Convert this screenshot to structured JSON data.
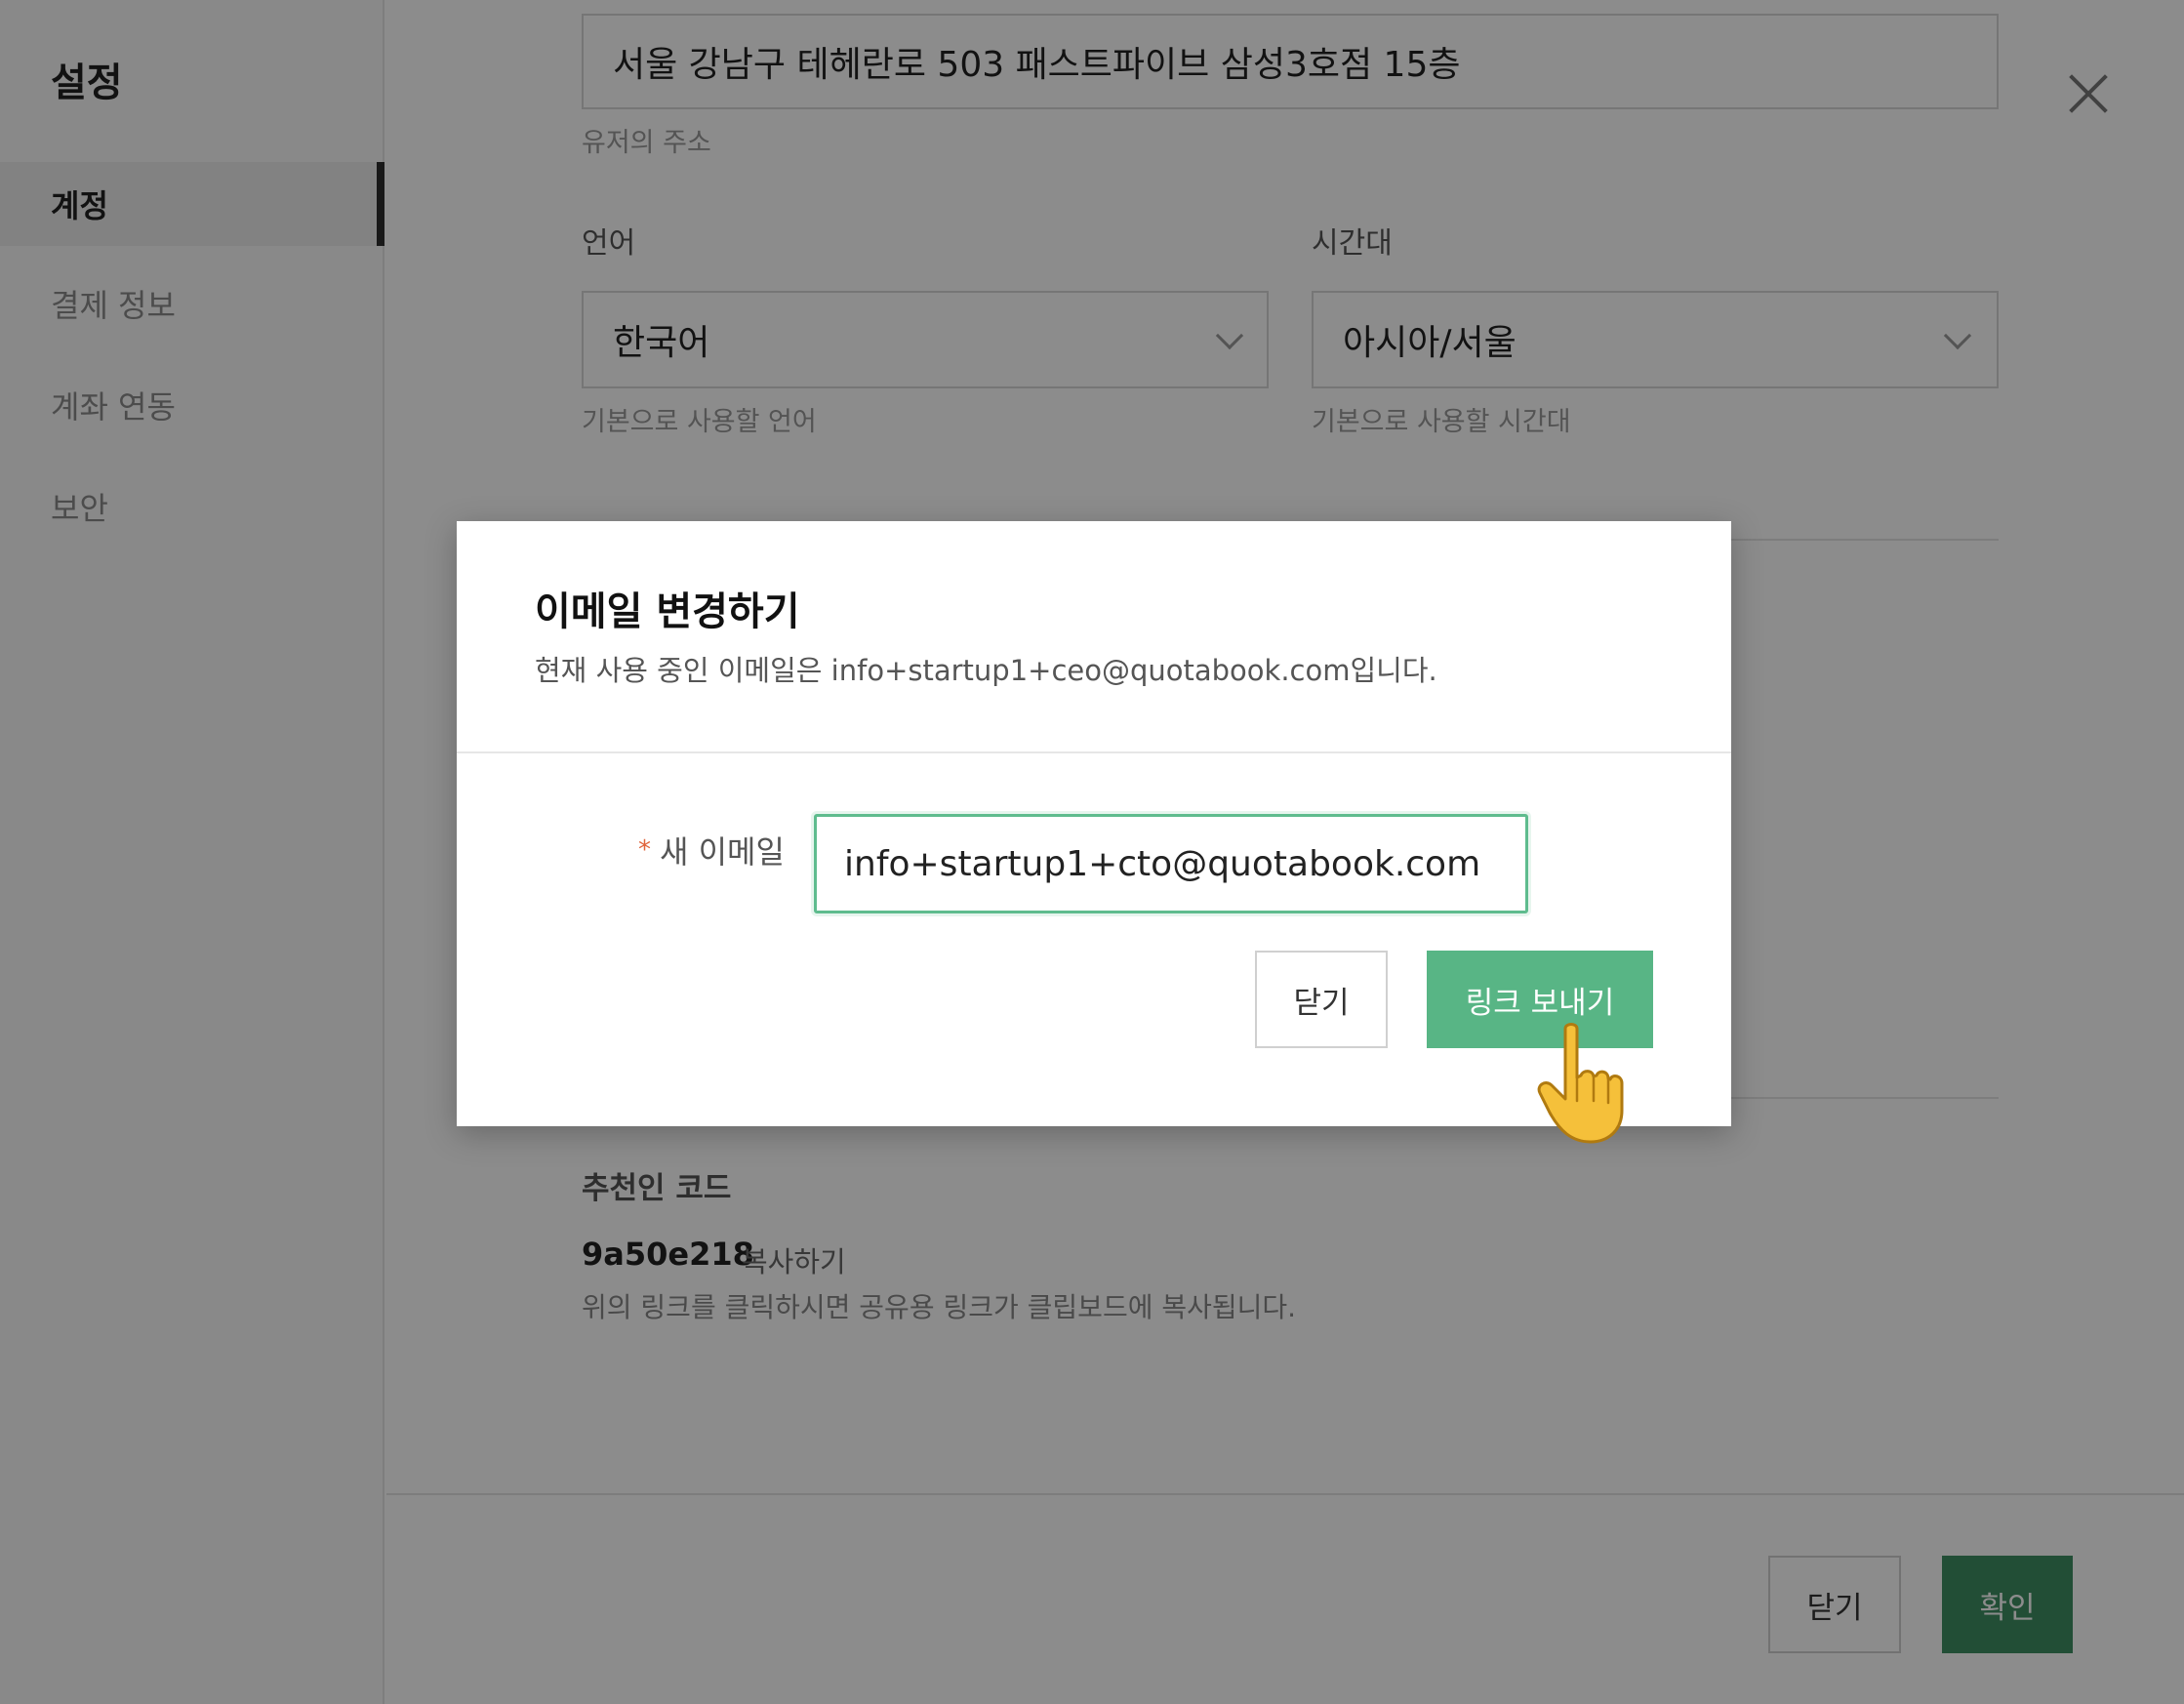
{
  "sidebar": {
    "title": "설정",
    "items": [
      {
        "label": "계정",
        "active": true
      },
      {
        "label": "결제 정보",
        "active": false
      },
      {
        "label": "계좌 연동",
        "active": false
      },
      {
        "label": "보안",
        "active": false
      }
    ]
  },
  "form": {
    "address_value": "서울 강남구 테헤란로 503 패스트파이브 삼성3호점 15층",
    "address_hint": "유저의 주소",
    "language_label": "언어",
    "language_value": "한국어",
    "language_hint": "기본으로 사용할 언어",
    "timezone_label": "시간대",
    "timezone_value": "아시아/서울",
    "timezone_hint": "기본으로 사용할 시간대"
  },
  "referral": {
    "title": "추천인 코드",
    "code": "9a50e218",
    "copy_label": "복사하기",
    "hint": "위의 링크를 클릭하시면 공유용 링크가 클립보드에 복사됩니다."
  },
  "footer": {
    "close_label": "닫기",
    "confirm_label": "확인"
  },
  "modal": {
    "title": "이메일 변경하기",
    "description": "현재 사용 중인 이메일은 info+startup1+ceo@quotabook.com입니다.",
    "required_mark": "*",
    "field_label": "새 이메일",
    "email_value": "info+startup1+cto@quotabook.com",
    "close_label": "닫기",
    "send_label": "링크 보내기"
  },
  "colors": {
    "accent": "#58b585",
    "focus_border": "#5fbc8e"
  },
  "icons": {
    "close": "close-icon",
    "dropdown": "chevron-down-icon",
    "cursor": "pointing-hand-icon"
  }
}
